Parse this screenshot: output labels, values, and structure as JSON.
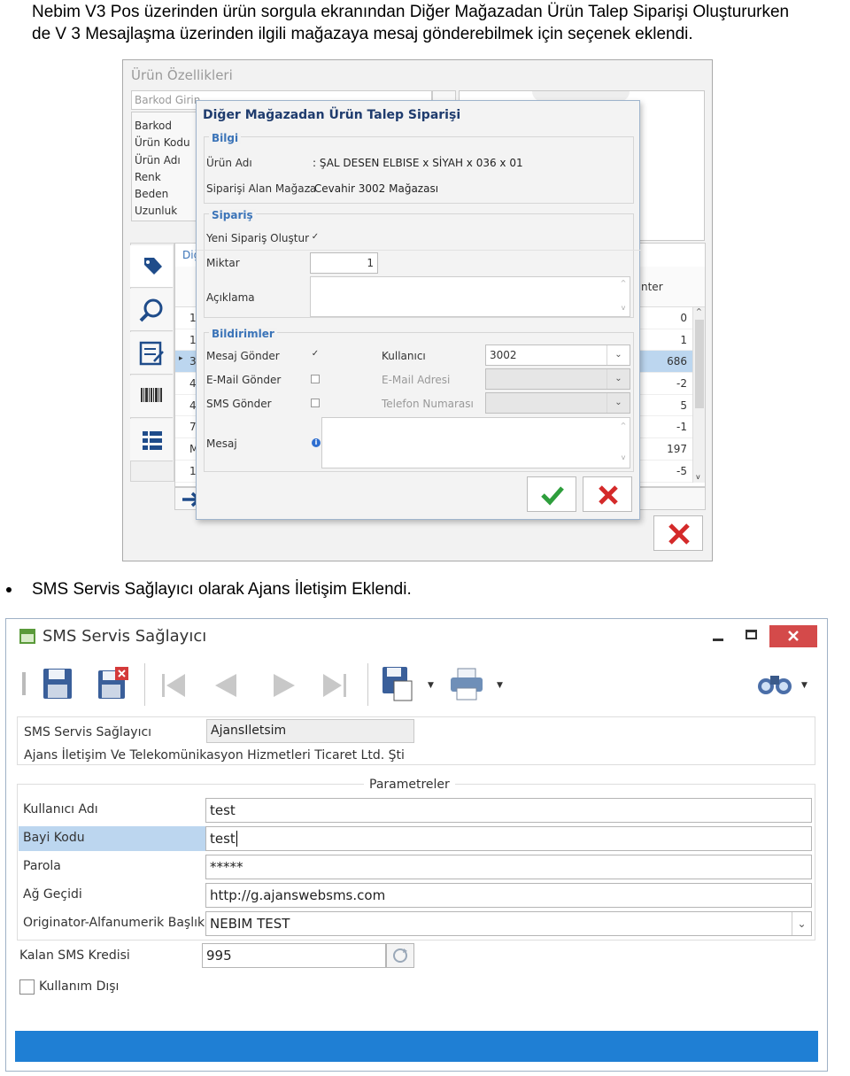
{
  "doc": {
    "intro_line1": "Nebim V3 Pos üzerinden ürün sorgula ekranından Diğer Mağazadan Ürün Talep Siparişi Oluştururken",
    "intro_line2": "de V 3 Mesajlaşma üzerinden ilgili mağazaya mesaj gönderebilmek için seçenek eklendi.",
    "bullet": "SMS Servis Sağlayıcı olarak Ajans İletişim Eklendi."
  },
  "product_window": {
    "title": "Ürün Özellikleri",
    "barcode_placeholder": "Barkod Girin",
    "fields": [
      "Barkod",
      "Ürün Kodu",
      "Ürün Adı",
      "Renk",
      "Beden",
      "Uzunluk"
    ],
    "tab_label": "Diğ",
    "grid_header_last": "nter",
    "row_prefixes": [
      "1",
      "1",
      "3",
      "4",
      "4",
      "7",
      "M",
      "1"
    ],
    "row_values": [
      "0",
      "1",
      "686",
      "-2",
      "5",
      "-1",
      "197",
      "-5"
    ]
  },
  "order_dialog": {
    "title": "Diğer Mağazadan Ürün Talep Siparişi",
    "info_group": "Bilgi",
    "product_name_label": "Ürün Adı",
    "product_name_value": ": ŞAL DESEN ELBISE x SİYAH x 036 x 01",
    "store_label": "Siparişi Alan Mağaza",
    "store_value": ": Cevahir 3002    Mağazası",
    "order_group": "Sipariş",
    "new_order_label": "Yeni Sipariş Oluştur",
    "qty_label": "Miktar",
    "qty_value": "1",
    "desc_label": "Açıklama",
    "notify_group": "Bildirimler",
    "send_message_label": "Mesaj Gönder",
    "send_email_label": "E-Mail Gönder",
    "send_sms_label": "SMS Gönder",
    "user_label": "Kullanıcı",
    "user_value": "3002",
    "email_label": "E-Mail Adresi",
    "phone_label": "Telefon Numarası",
    "message_label": "Mesaj",
    "new_order_checked": true,
    "send_message_checked": true,
    "send_email_checked": false,
    "send_sms_checked": false
  },
  "sms_window": {
    "title": "SMS Servis Sağlayıcı",
    "provider_label": "SMS Servis Sağlayıcı",
    "provider_code": "AjansIletsim",
    "provider_fullname": "Ajans İletişim Ve Telekomünikasyon Hizmetleri Ticaret Ltd. Şti",
    "params_group": "Parametreler",
    "username_label": "Kullanıcı Adı",
    "username_value": "test",
    "dealer_label": "Bayi Kodu",
    "dealer_value": "test",
    "password_label": "Parola",
    "password_value": "*****",
    "gateway_label": "Ağ Geçidi",
    "gateway_value": "http://g.ajanswebsms.com",
    "originator_label": "Originator-Alfanumerik Başlık",
    "originator_value": "NEBIM TEST",
    "credit_label": "Kalan SMS Kredisi",
    "credit_value": "995",
    "disabled_label": "Kullanım Dışı",
    "disabled_checked": false
  },
  "colors": {
    "accent_blue": "#1f7fd4",
    "confirm_green": "#2e9e3c",
    "cancel_red": "#d42a2a",
    "selected_row": "#bcd6ef",
    "close_btn": "#d44a4a"
  }
}
